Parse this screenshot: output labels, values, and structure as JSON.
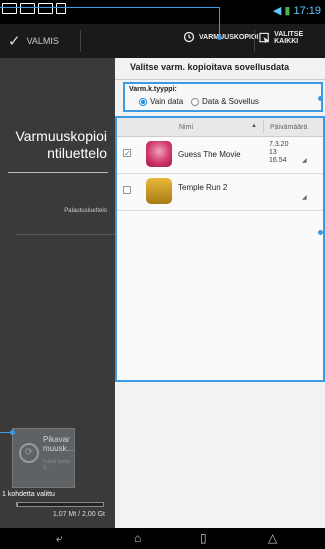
{
  "status": {
    "time": "17:19"
  },
  "actionbar": {
    "done_label": "VALMIS",
    "backup_label": "VARMUUSKOPIOI",
    "selectall_label": "VALITSE KAIKKI"
  },
  "sidebar": {
    "title": "Varmuuskopioi ntiluettelo",
    "link": "Palautusluettelo"
  },
  "quick": {
    "label": "Pikavar muusk...",
    "sub": "Kaikki tiedot &..."
  },
  "selection": {
    "count_text": "1 kohdetta valittu",
    "storage_text": "1,07 Mt / 2,00 Gt",
    "storage_used_fraction": 0.01
  },
  "main": {
    "title": "Valitse varm. kopioitava sovellusdata",
    "type_label": "Varm.k.tyyppi:",
    "option_data": "Vain data",
    "option_both": "Data & Sovellus"
  },
  "list": {
    "col_name": "Nimi",
    "col_date": "Päivämäärä",
    "rows": [
      {
        "name": "Guess The Movie",
        "date_line1": "7.3.20",
        "date_line2": "13",
        "date_line3": "16.54",
        "checked": true
      },
      {
        "name": "Temple Run 2",
        "date_line1": "",
        "date_line2": "",
        "date_line3": "",
        "checked": false
      }
    ]
  },
  "colors": {
    "accent": "#3a9be4",
    "sidebar": "#3a3a3a",
    "actionbar": "#1a1a1a"
  }
}
